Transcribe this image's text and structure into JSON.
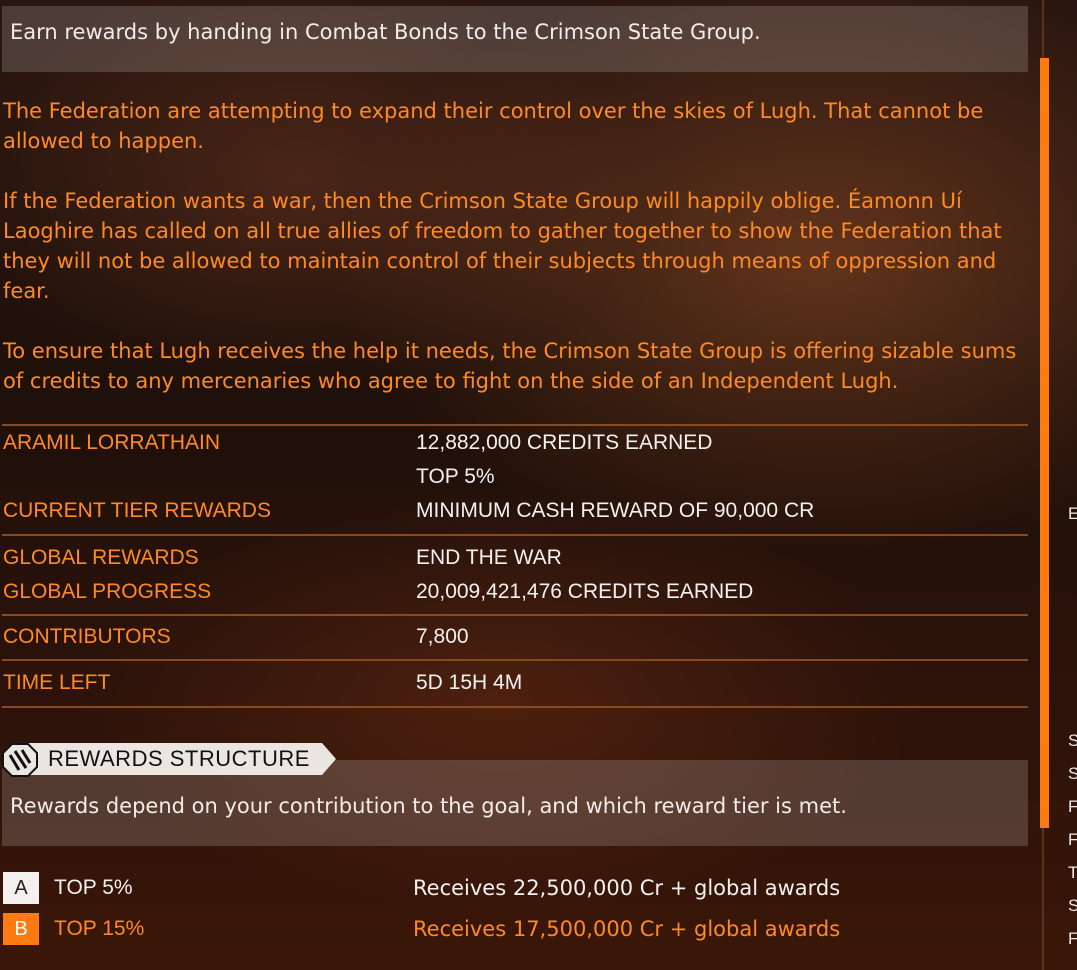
{
  "header_text": "Earn rewards by handing in Combat Bonds to the Crimson State Group.",
  "description": [
    "The Federation are attempting to expand their control over the skies of Lugh. That cannot be allowed to happen.",
    "If the Federation wants a war, then the Crimson State Group will happily oblige. Éamonn Uí Laoghire has called on all true allies of freedom to gather together to show the Federation that they will not be allowed to maintain control of their subjects through means of oppression and fear.",
    "To ensure that Lugh receives the help it needs, the Crimson State Group is offering sizable sums of credits to any mercenaries who agree to fight on the side of an Independent Lugh."
  ],
  "stats": {
    "player_name": "ARAMIL LORRATHAIN",
    "player_earned": "12,882,000 CREDITS EARNED",
    "player_rank": "TOP 5%",
    "current_tier_label": "CURRENT TIER REWARDS",
    "current_tier_value": "MINIMUM CASH REWARD OF 90,000 CR",
    "global_rewards_label": "GLOBAL REWARDS",
    "global_rewards_value": "END THE WAR",
    "global_progress_label": "GLOBAL PROGRESS",
    "global_progress_value": "20,009,421,476 CREDITS EARNED",
    "contributors_label": "CONTRIBUTORS",
    "contributors_value": "7,800",
    "time_left_label": "TIME LEFT",
    "time_left_value": "5D 15H 4M"
  },
  "rewards_section": {
    "title": "REWARDS STRUCTURE",
    "icon": "mechanical-handshake-icon",
    "description": "Rewards depend on your contribution to the goal, and which reward tier is met."
  },
  "tiers": [
    {
      "badge": "A",
      "name": "TOP 5%",
      "reward": "Receives 22,500,000 Cr + global awards"
    },
    {
      "badge": "B",
      "name": "TOP 15%",
      "reward": "Receives 17,500,000 Cr + global awards"
    }
  ],
  "right_edge_letters": [
    "E",
    "S",
    "S",
    "F",
    "F",
    "T",
    "S",
    "F"
  ],
  "colors": {
    "accent_orange": "#ff8a24",
    "highlight_orange": "#ff7a10",
    "text_white": "#f4f0ee",
    "divider": "#8a4a1f"
  }
}
